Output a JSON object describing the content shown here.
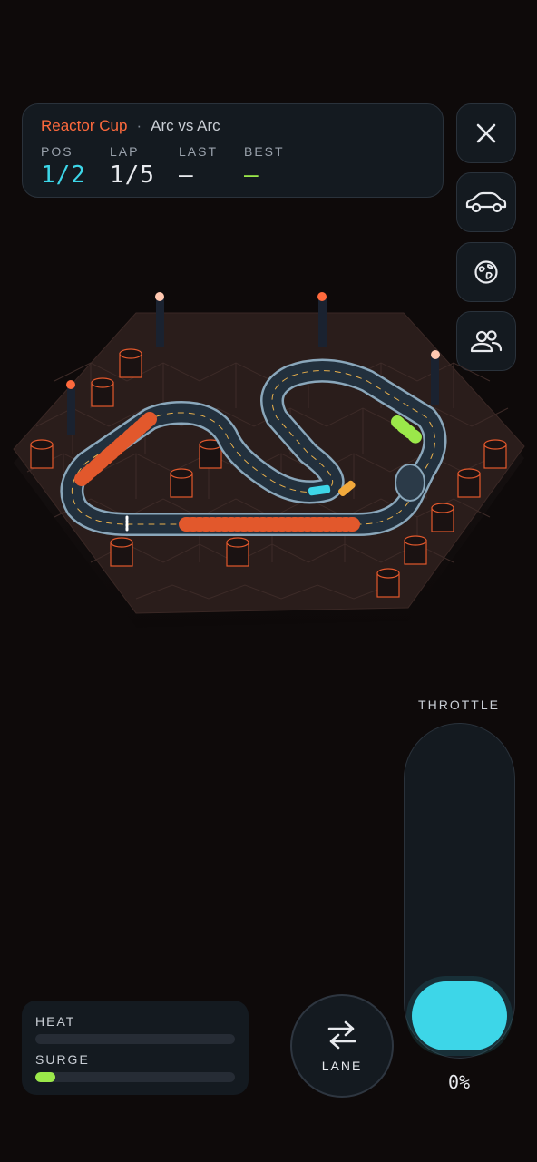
{
  "hud": {
    "race_name": "Reactor Cup",
    "separator": "·",
    "mode": "Arc vs Arc",
    "stats": [
      {
        "label": "POS",
        "value": "1/2",
        "color": "#3dd6e8"
      },
      {
        "label": "LAP",
        "value": "1/5",
        "color": "#e8eaee"
      },
      {
        "label": "LAST",
        "value": "—",
        "color": "#e8eaee"
      },
      {
        "label": "BEST",
        "value": "—",
        "color": "#9be84a"
      }
    ]
  },
  "side_buttons": [
    {
      "icon": "close-icon"
    },
    {
      "icon": "car-icon"
    },
    {
      "icon": "globe-icon"
    },
    {
      "icon": "players-icon"
    }
  ],
  "throttle": {
    "label": "THROTTLE",
    "value": 0,
    "display": "0%",
    "color": "#3dd6e8"
  },
  "meters": {
    "heat": {
      "label": "HEAT",
      "value": 0.0
    },
    "surge": {
      "label": "SURGE",
      "value": 0.1,
      "color": "#9be84a"
    }
  },
  "lane": {
    "label": "LANE",
    "icon": "swap-arrows-icon"
  },
  "colors": {
    "accent_orange": "#ff6a3d",
    "accent_cyan": "#3dd6e8",
    "accent_green": "#9be84a",
    "panel": "#141a20"
  }
}
